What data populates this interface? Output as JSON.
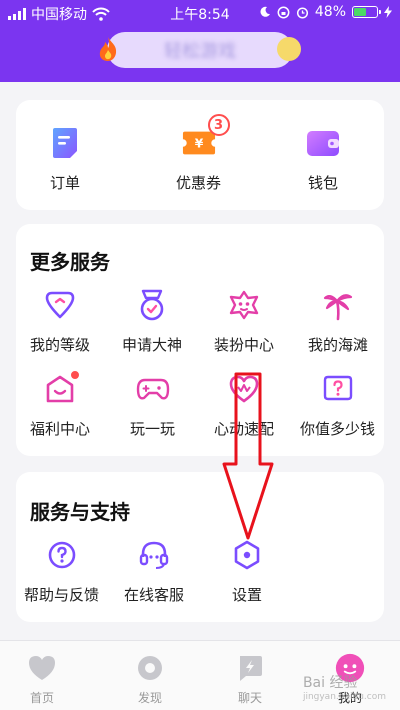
{
  "status_bar": {
    "carrier": "中国移动",
    "time": "上午8:54",
    "battery": "48%",
    "battery_level": 0.48
  },
  "header": {
    "title": "轻松游戏"
  },
  "quick_actions": [
    {
      "label": "订单",
      "icon": "order-icon"
    },
    {
      "label": "优惠券",
      "icon": "coupon-icon",
      "badge": "3"
    },
    {
      "label": "钱包",
      "icon": "wallet-icon"
    }
  ],
  "more_services": {
    "title": "更多服务",
    "items": [
      {
        "label": "我的等级",
        "icon": "level-icon"
      },
      {
        "label": "申请大神",
        "icon": "medal-icon"
      },
      {
        "label": "装扮中心",
        "icon": "dress-up-icon"
      },
      {
        "label": "我的海滩",
        "icon": "palm-tree-icon"
      },
      {
        "label": "福利中心",
        "icon": "gift-house-icon"
      },
      {
        "label": "玩一玩",
        "icon": "gamepad-icon"
      },
      {
        "label": "心动速配",
        "icon": "heart-match-icon"
      },
      {
        "label": "你值多少钱",
        "icon": "question-tag-icon"
      }
    ]
  },
  "support": {
    "title": "服务与支持",
    "items": [
      {
        "label": "帮助与反馈",
        "icon": "help-icon"
      },
      {
        "label": "在线客服",
        "icon": "headset-icon"
      },
      {
        "label": "设置",
        "icon": "settings-icon"
      }
    ]
  },
  "tabbar": [
    {
      "label": "首页",
      "icon": "home-heart-icon"
    },
    {
      "label": "发现",
      "icon": "discover-icon"
    },
    {
      "label": "聊天",
      "icon": "chat-icon"
    },
    {
      "label": "我的",
      "icon": "profile-icon",
      "active": true
    }
  ],
  "watermark": {
    "text": "Bai 经验",
    "sub": "jingyan.baidu.com"
  },
  "colors": {
    "header": "#7b35f0",
    "accent": "#7b4dff",
    "pink": "#e33ea8",
    "badge": "#ff4e4e",
    "annotation": "#e8121c"
  }
}
